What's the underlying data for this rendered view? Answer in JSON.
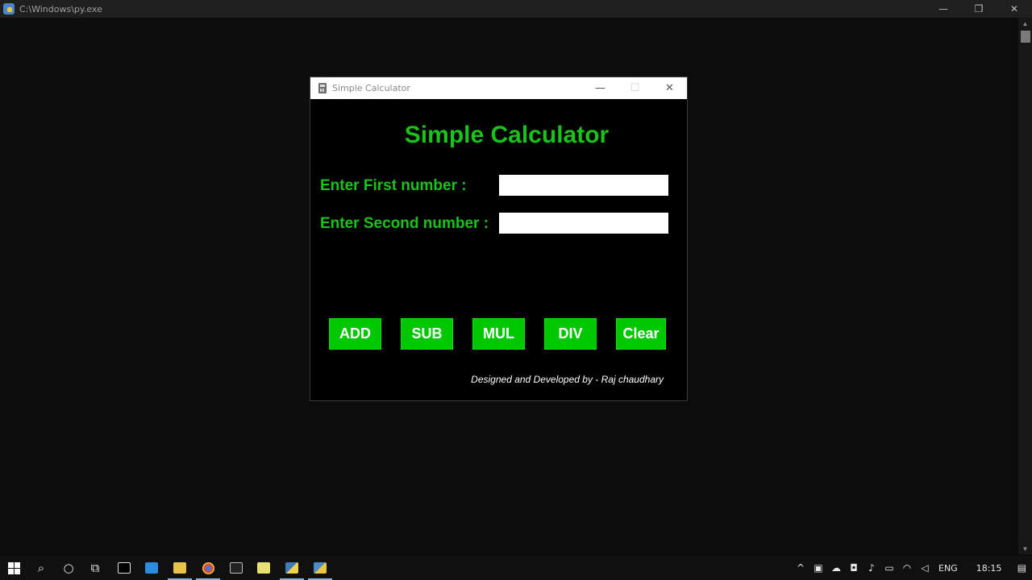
{
  "console_window": {
    "title": "C:\\Windows\\py.exe",
    "controls": {
      "minimize": "—",
      "restore": "❐",
      "close": "✕"
    }
  },
  "calculator": {
    "window_title": "Simple Calculator",
    "controls": {
      "minimize": "—",
      "maximize": "☐",
      "close": "✕"
    },
    "heading": "Simple Calculator",
    "first_label": "Enter First number :",
    "second_label": "Enter Second number :",
    "first_value": "",
    "second_value": "",
    "buttons": {
      "add": "ADD",
      "sub": "SUB",
      "mul": "MUL",
      "div": "DIV",
      "clear": "Clear"
    },
    "credit": "Designed and Developed by - Raj chaudhary",
    "colors": {
      "accent_text": "#19c319",
      "button_bg": "#00c800",
      "window_bg": "#000000"
    }
  },
  "taskbar": {
    "icons": [
      "windows-start-icon",
      "search-icon",
      "cortana-icon",
      "task-view-icon",
      "pycharm-icon",
      "vscode-icon",
      "file-explorer-icon",
      "chrome-icon",
      "cmd-icon",
      "notepad-icon",
      "python-launcher-icon",
      "python-idle-icon"
    ],
    "language": "ENG",
    "time": "18:15",
    "glyphs": {
      "search": "⌕",
      "cortana": "○",
      "task_view": "⧉",
      "chevron": "^",
      "notification": "▤"
    }
  }
}
